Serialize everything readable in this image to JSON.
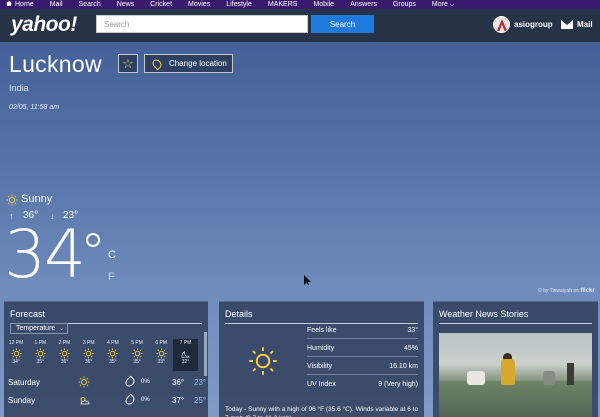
{
  "nav": {
    "items": [
      "Home",
      "Mail",
      "Search",
      "News",
      "Cricket",
      "Movies",
      "Lifestyle",
      "MAKERS",
      "Mobile",
      "Answers",
      "Groups",
      "More"
    ]
  },
  "header": {
    "logo": "yahoo!",
    "search_placeholder": "Search",
    "search_button": "Search",
    "username": "asiogroup",
    "mail_label": "Mail"
  },
  "location": {
    "city": "Lucknow",
    "country": "India",
    "change_label": "Change location",
    "datetime": "02/05, 11:58 am"
  },
  "current": {
    "condition": "Sunny",
    "condition_icon": "sun-icon",
    "high": "36°",
    "low": "23°",
    "temp": "34",
    "unit_c": "C",
    "unit_f": "F"
  },
  "photo_credit": {
    "prefix": "© by Tinwaiyah on",
    "brand": "flickr"
  },
  "forecast": {
    "title": "Forecast",
    "selector": "Temperature",
    "hourly": [
      {
        "time": "12 PM",
        "temp": "34°",
        "icon": "sun-icon"
      },
      {
        "time": "1 PM",
        "temp": "35°",
        "icon": "sun-icon"
      },
      {
        "time": "2 PM",
        "temp": "36°",
        "icon": "sun-icon"
      },
      {
        "time": "3 PM",
        "temp": "36°",
        "icon": "sun-icon"
      },
      {
        "time": "4 PM",
        "temp": "35°",
        "icon": "sun-icon"
      },
      {
        "time": "5 PM",
        "temp": "35°",
        "icon": "sun-icon"
      },
      {
        "time": "6 PM",
        "temp": "33°",
        "icon": "sun-icon"
      },
      {
        "time": "7 PM",
        "temp": "32°",
        "icon": "moon-icon"
      }
    ],
    "daily": [
      {
        "day": "Saturday",
        "precip": "0%",
        "high": "36°",
        "low": "23°",
        "icon": "sun-icon"
      },
      {
        "day": "Sunday",
        "precip": "0%",
        "high": "37°",
        "low": "25°",
        "icon": "partly-sunny-icon"
      }
    ]
  },
  "details": {
    "title": "Details",
    "rows": [
      {
        "label": "Feels like",
        "value": "33°"
      },
      {
        "label": "Humidity",
        "value": "45%"
      },
      {
        "label": "Visibility",
        "value": "16.10 km"
      },
      {
        "label": "UV Index",
        "value": "9 (Very high)"
      }
    ],
    "summary": "Today - Sunny with a high of 96 °F (35.6 °C). Winds variable at 6 to 7 mph (9.7 to 11.3 kph)."
  },
  "news": {
    "title": "Weather News Stories"
  },
  "colors": {
    "nav_bg": "#3a1a6e",
    "header_bg": "#273347",
    "search_button": "#1f7ae0",
    "accent_yellow": "#ffd43b",
    "low_temp": "#8fc3ff"
  }
}
